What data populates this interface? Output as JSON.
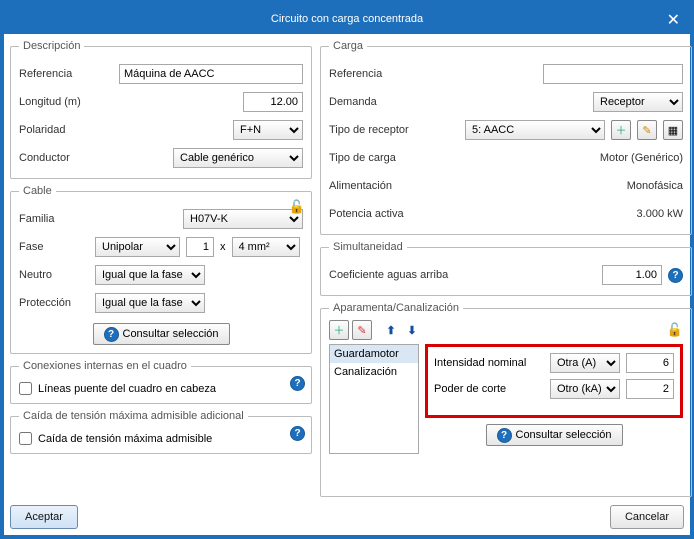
{
  "window": {
    "title": "Circuito con carga concentrada",
    "close": "✕"
  },
  "descripcion": {
    "legend": "Descripción",
    "referencia_lbl": "Referencia",
    "referencia_val": "Máquina de AACC",
    "longitud_lbl": "Longitud (m)",
    "longitud_val": "12.00",
    "polaridad_lbl": "Polaridad",
    "polaridad_val": "F+N",
    "conductor_lbl": "Conductor",
    "conductor_val": "Cable genérico"
  },
  "cable": {
    "legend": "Cable",
    "familia_lbl": "Familia",
    "familia_val": "H07V-K",
    "fase_lbl": "Fase",
    "fase_val": "Unipolar",
    "fase_n": "1",
    "fase_x": "x",
    "fase_area": "4 mm²",
    "neutro_lbl": "Neutro",
    "neutro_val": "Igual que la fase",
    "proteccion_lbl": "Protección",
    "proteccion_val": "Igual que la fase",
    "consultar": "Consultar selección"
  },
  "conexiones": {
    "legend": "Conexiones internas en el cuadro",
    "chk_label": "Líneas puente del cuadro en cabeza"
  },
  "caida": {
    "legend": "Caída de tensión máxima admisible adicional",
    "chk_label": "Caída de tensión máxima admisible"
  },
  "carga": {
    "legend": "Carga",
    "referencia_lbl": "Referencia",
    "referencia_val": "",
    "demanda_lbl": "Demanda",
    "demanda_val": "Receptor",
    "tipo_receptor_lbl": "Tipo de receptor",
    "tipo_receptor_val": "5: AACC",
    "tipo_carga_lbl": "Tipo de carga",
    "tipo_carga_val": "Motor (Genérico)",
    "alimentacion_lbl": "Alimentación",
    "alimentacion_val": "Monofásica",
    "potencia_lbl": "Potencia activa",
    "potencia_val": "3.000 kW"
  },
  "simultaneidad": {
    "legend": "Simultaneidad",
    "coef_lbl": "Coeficiente aguas arriba",
    "coef_val": "1.00"
  },
  "aparamenta": {
    "legend": "Aparamenta/Canalización",
    "list": [
      "Guardamotor",
      "Canalización"
    ],
    "intensidad_lbl": "Intensidad nominal",
    "intensidad_sel": "Otra (A)",
    "intensidad_val": "6",
    "poder_lbl": "Poder de corte",
    "poder_sel": "Otro (kA)",
    "poder_val": "2",
    "consultar": "Consultar selección"
  },
  "buttons": {
    "aceptar": "Aceptar",
    "cancelar": "Cancelar"
  },
  "icons": {
    "help": "?",
    "lock": "🔓",
    "add": "＋",
    "delete": "✎",
    "edit": "✎",
    "grid": "▦",
    "up": "⬆",
    "down": "⬇",
    "swap": "⇄"
  }
}
